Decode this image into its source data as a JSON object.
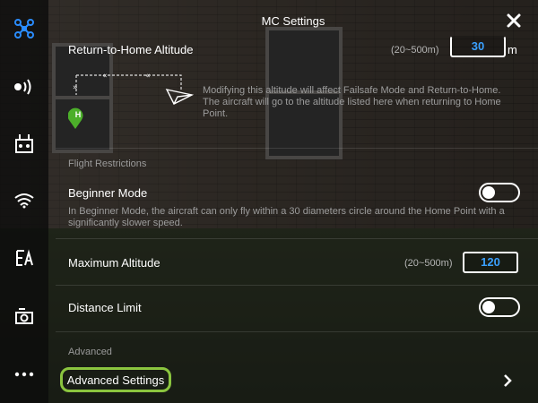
{
  "header": {
    "title": "MC Settings"
  },
  "sidebar": {
    "items": [
      {
        "icon": "drone-icon",
        "active": true
      },
      {
        "icon": "signal-icon"
      },
      {
        "icon": "remote-controller-icon"
      },
      {
        "icon": "wifi-icon"
      },
      {
        "icon": "image-transmission-icon"
      },
      {
        "icon": "camera-icon"
      },
      {
        "icon": "more-icon"
      }
    ]
  },
  "rth": {
    "label": "Return-to-Home Altitude",
    "range": "(20~500m)",
    "value": "30",
    "unit": "m",
    "home_marker": "H",
    "description": "Modifying this altitude will affect Failsafe Mode and Return-to-Home. The aircraft will go to the altitude listed here when returning to Home Point."
  },
  "flight_restrictions": {
    "section_label": "Flight Restrictions",
    "beginner_mode": {
      "label": "Beginner Mode",
      "enabled": false,
      "description": "In Beginner Mode, the aircraft can only fly within a 30 diameters circle around the Home Point with a significantly slower speed."
    },
    "max_altitude": {
      "label": "Maximum Altitude",
      "range": "(20~500m)",
      "value": "120"
    },
    "distance_limit": {
      "label": "Distance Limit",
      "enabled": false
    }
  },
  "advanced": {
    "section_label": "Advanced",
    "settings_label": "Advanced Settings"
  },
  "colors": {
    "accent": "#3aa0ff",
    "highlight": "#8bc53f",
    "home_marker": "#4caf2a"
  }
}
